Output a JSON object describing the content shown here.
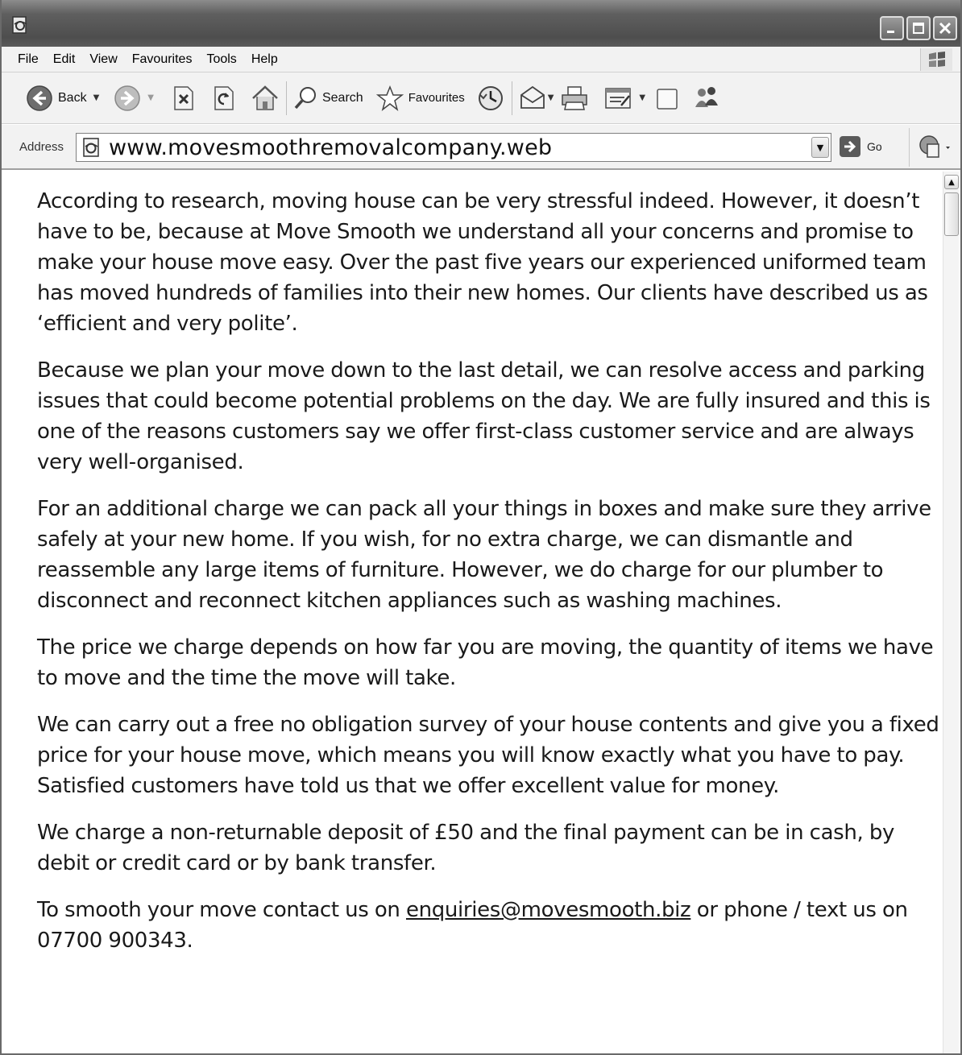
{
  "menu": {
    "items": [
      "File",
      "Edit",
      "View",
      "Favourites",
      "Tools",
      "Help"
    ]
  },
  "toolbar": {
    "back_label": "Back",
    "search_label": "Search",
    "favourites_label": "Favourites"
  },
  "address": {
    "label": "Address",
    "url": "www.movesmoothremovalcompany.web",
    "go_label": "Go"
  },
  "article": {
    "p1": "According to research, moving house can be very stressful indeed. However, it doesn’t have to be, because at Move Smooth we understand all your concerns and promise to make your house move easy. Over the past five years our experienced uniformed team has moved hundreds of families into their new homes. Our clients have described us as ‘efficient and very polite’.",
    "p2": "Because we plan your move down to the last detail, we can resolve access and parking issues that could become potential problems on the day. We are fully insured and this is one of the reasons customers say we offer first-class customer service and are always very well-organised.",
    "p3": "For an additional charge we can pack all your things in boxes and make sure they arrive safely at your new home. If you wish, for no extra charge, we can dismantle and reassemble any large items of furniture. However, we do charge for our plumber to disconnect and reconnect kitchen appliances such as washing machines.",
    "p4": "The price we charge depends on how far you are moving, the quantity of items we have to move and the time the move will take.",
    "p5": "We can carry out a free no obligation survey of your house contents and give you a fixed price for your house move, which means you will know exactly what you have to pay. Satisfied customers have told us that we offer excellent value for money.",
    "p6": "We charge a non-returnable deposit of £50 and the final payment can be in cash, by debit or credit card or by bank transfer.",
    "p7_before": "To smooth your move contact us on ",
    "p7_email": "enquiries@movesmooth.biz",
    "p7_after": " or phone / text us on 07700 900343."
  },
  "icons": {
    "title": "ie-page-icon",
    "window_controls": [
      "minimize-icon",
      "maximize-icon",
      "close-icon"
    ],
    "toolbar": [
      "back-icon",
      "forward-icon",
      "stop-icon",
      "refresh-icon",
      "home-icon",
      "search-icon",
      "favourites-star-icon",
      "history-icon",
      "mail-icon",
      "print-icon",
      "edit-icon",
      "discuss-icon",
      "messenger-icon"
    ]
  }
}
